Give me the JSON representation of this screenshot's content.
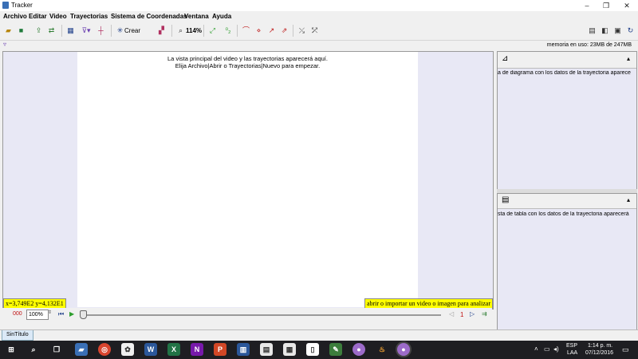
{
  "window": {
    "title": "Tracker"
  },
  "window_controls": {
    "minimize": "–",
    "maximize": "❐",
    "close": "✕"
  },
  "menu": [
    "Archivo",
    "Editar",
    "Video",
    "Trayectorias",
    "Sistema de Coordenadas",
    "Ventana",
    "Ayuda"
  ],
  "toolbar": {
    "create_label": "Crear",
    "zoom_label": "114%"
  },
  "status": {
    "memory": "memoria en uso: 23MB de 247MB"
  },
  "video": {
    "message_line1": "La vista principal del video y las trayectorias aparecerá aquí.",
    "message_line2": "Elija Archivo|Abrir o Trayectorias|Nuevo para empezar.",
    "coords": "x=3,749E2  y=4,132E1",
    "import_hint": "abrir o importar un video o imagen para analizar"
  },
  "player": {
    "frame": "000",
    "zoom": "100%",
    "step": "1"
  },
  "plot_panel": {
    "message": "a de diagrama con los datos de la trayectoria aparece"
  },
  "table_panel": {
    "message": "sta de tabla con los datos de la trayectoria aparecerá"
  },
  "tabs": [
    "SinTítulo"
  ],
  "taskbar": {
    "lang": "ESP",
    "lang2": "LAA",
    "time": "1:14 p. m.",
    "date": "07/12/2016"
  },
  "colors": {
    "accent": "#3a6fb5",
    "highlight": "#ffff00",
    "counter": "#c01010",
    "taskbar": "#1e1e22"
  }
}
